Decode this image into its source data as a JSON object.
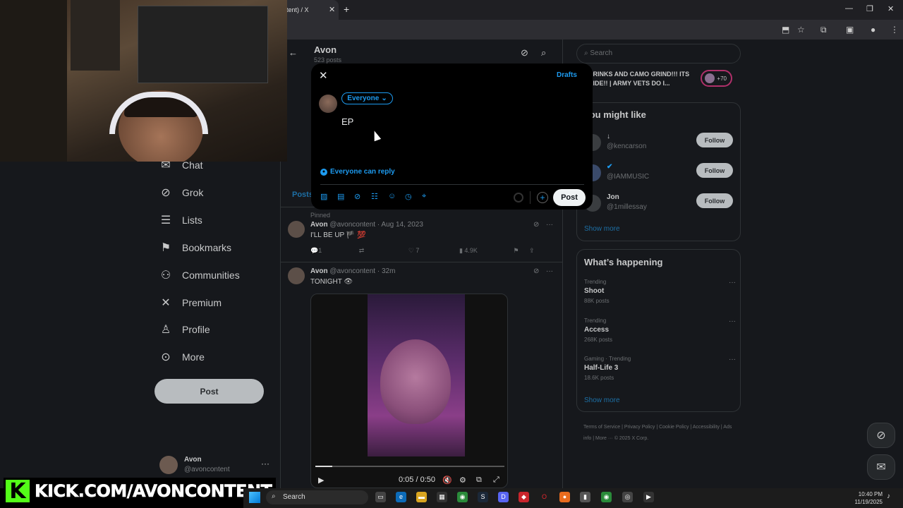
{
  "browser": {
    "tab_title": "tent) / X",
    "tab_close": "✕",
    "new_tab": "+",
    "win_min": "—",
    "win_max": "❐",
    "win_close": "✕"
  },
  "nav": {
    "items": [
      {
        "label": "Chat",
        "icon": "chat-icon"
      },
      {
        "label": "Grok",
        "icon": "grok-icon"
      },
      {
        "label": "Lists",
        "icon": "lists-icon"
      },
      {
        "label": "Bookmarks",
        "icon": "bookmark-icon"
      },
      {
        "label": "Communities",
        "icon": "communities-icon"
      },
      {
        "label": "Premium",
        "icon": "x-icon"
      },
      {
        "label": "Profile",
        "icon": "profile-icon"
      },
      {
        "label": "More",
        "icon": "more-icon"
      }
    ],
    "post_button": "Post",
    "account_name": "Avon",
    "account_handle": "@avoncontent",
    "account_more": "···"
  },
  "profile": {
    "title": "Avon",
    "post_count": "523 posts",
    "posts_tab": "Posts"
  },
  "tweets": [
    {
      "pinned_label": "Pinned",
      "name": "Avon",
      "meta": "@avoncontent · Aug 14, 2023",
      "text": "I'LL BE UP 🏴 💯",
      "replies": "1",
      "likes": "7",
      "views": "4.9K"
    },
    {
      "name": "Avon",
      "meta": "@avoncontent · 32m",
      "text": "TONIGHT 👁",
      "video_time": "0:05 / 0:50"
    }
  ],
  "right": {
    "search_placeholder": "Search",
    "live_text": "DRINKS AND CAMO GRIND!!! ITS RIDE!! | ARMY VETS DO I...",
    "live_count": "+70",
    "who_title": "You might like",
    "who": [
      {
        "name": "↓",
        "handle": "@kencarson",
        "follow": "Follow"
      },
      {
        "name": "",
        "handle": "@IAMMUSIC",
        "follow": "Follow"
      },
      {
        "name": "Jon",
        "handle": "@1millessay",
        "follow": "Follow"
      }
    ],
    "show_more": "Show more",
    "happening_title": "What’s happening",
    "trends": [
      {
        "category": "Trending",
        "title": "Shoot",
        "count": "88K posts"
      },
      {
        "category": "Trending",
        "title": "Access",
        "count": "268K posts"
      },
      {
        "category": "Gaming · Trending",
        "title": "Half-Life 3",
        "count": "18.6K posts"
      }
    ],
    "show_more_2": "Show more",
    "footer": "Terms of Service  |  Privacy Policy  |  Cookie Policy  |  Accessibility  |  Ads info  |  More ···  © 2025 X Corp."
  },
  "composer": {
    "drafts": "Drafts",
    "audience": "Everyone",
    "text": "EP",
    "reply_setting": "Everyone can reply",
    "post_button": "Post"
  },
  "overlay": {
    "kick_logo": "K",
    "kick_url": "KICK.COM/AVONCONTENT"
  },
  "taskbar": {
    "search": "Search",
    "time": "10:40 PM",
    "date": "11/19/2025"
  }
}
